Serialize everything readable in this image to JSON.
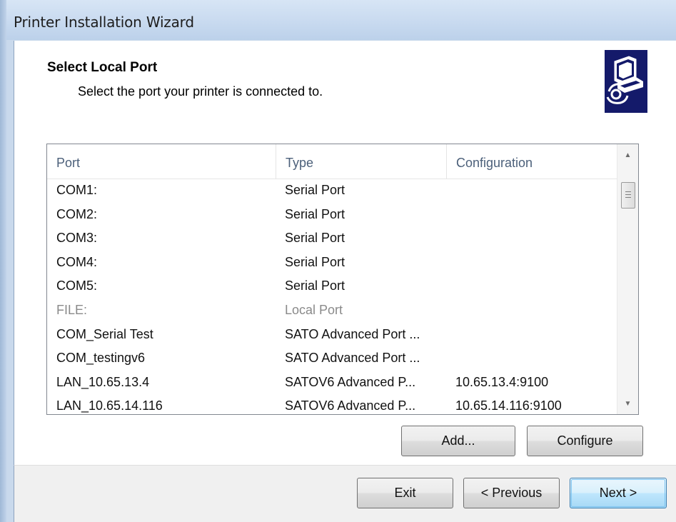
{
  "window": {
    "title": "Printer Installation Wizard"
  },
  "header": {
    "title": "Select Local Port",
    "subtitle": "Select the port your printer is connected to.",
    "icon": "printer-wizard-icon"
  },
  "port_list": {
    "columns": [
      "Port",
      "Type",
      "Configuration"
    ],
    "rows": [
      {
        "port": "COM1:",
        "type": "Serial Port",
        "configuration": "",
        "disabled": false
      },
      {
        "port": "COM2:",
        "type": "Serial Port",
        "configuration": "",
        "disabled": false
      },
      {
        "port": "COM3:",
        "type": "Serial Port",
        "configuration": "",
        "disabled": false
      },
      {
        "port": "COM4:",
        "type": "Serial Port",
        "configuration": "",
        "disabled": false
      },
      {
        "port": "COM5:",
        "type": "Serial Port",
        "configuration": "",
        "disabled": false
      },
      {
        "port": "FILE:",
        "type": "Local Port",
        "configuration": "",
        "disabled": true
      },
      {
        "port": "COM_Serial Test",
        "type": "SATO Advanced Port ...",
        "configuration": "",
        "disabled": false
      },
      {
        "port": "COM_testingv6",
        "type": "SATO Advanced Port ...",
        "configuration": "",
        "disabled": false
      },
      {
        "port": "LAN_10.65.13.4",
        "type": "SATOV6 Advanced P...",
        "configuration": "10.65.13.4:9100",
        "disabled": false
      },
      {
        "port": "LAN_10.65.14.116",
        "type": "SATOV6 Advanced P...",
        "configuration": "10.65.14.116:9100",
        "disabled": false
      }
    ]
  },
  "buttons": {
    "add": "Add...",
    "configure": "Configure",
    "exit": "Exit",
    "previous": "< Previous",
    "next": "Next >"
  },
  "colors": {
    "accent": "#3c7fb1",
    "header_icon_bg": "#141a6a",
    "disabled_text": "#8a8a8a"
  }
}
